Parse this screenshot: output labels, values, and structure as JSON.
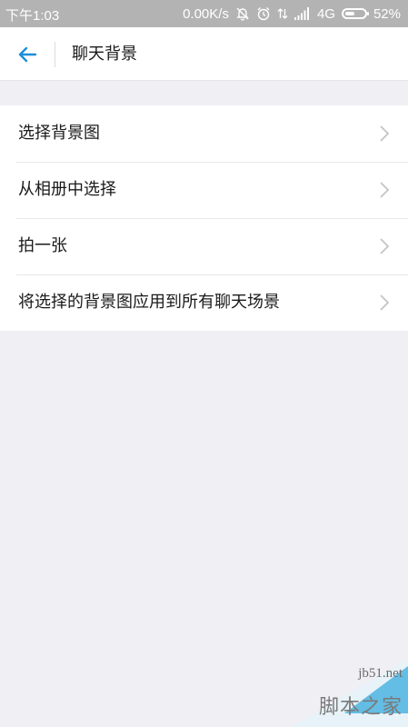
{
  "status_bar": {
    "time": "下午1:03",
    "network_speed": "0.00K/s",
    "network_type": "4G",
    "battery_percent": "52%",
    "battery_level": 0.52,
    "icons": [
      "alarm-off-icon",
      "alarm-clock-icon",
      "data-arrows-icon",
      "signal-icon",
      "battery-icon"
    ]
  },
  "header": {
    "back_icon": "arrow-left-icon",
    "title": "聊天背景",
    "accent_color": "#1e8ed8"
  },
  "menu": {
    "items": [
      {
        "label": "选择背景图"
      },
      {
        "label": "从相册中选择"
      },
      {
        "label": "拍一张"
      },
      {
        "label": "将选择的背景图应用到所有聊天场景"
      }
    ],
    "chevron_icon": "chevron-right-icon"
  },
  "watermark": {
    "url": "jb51.net",
    "name": "脚本之家"
  }
}
